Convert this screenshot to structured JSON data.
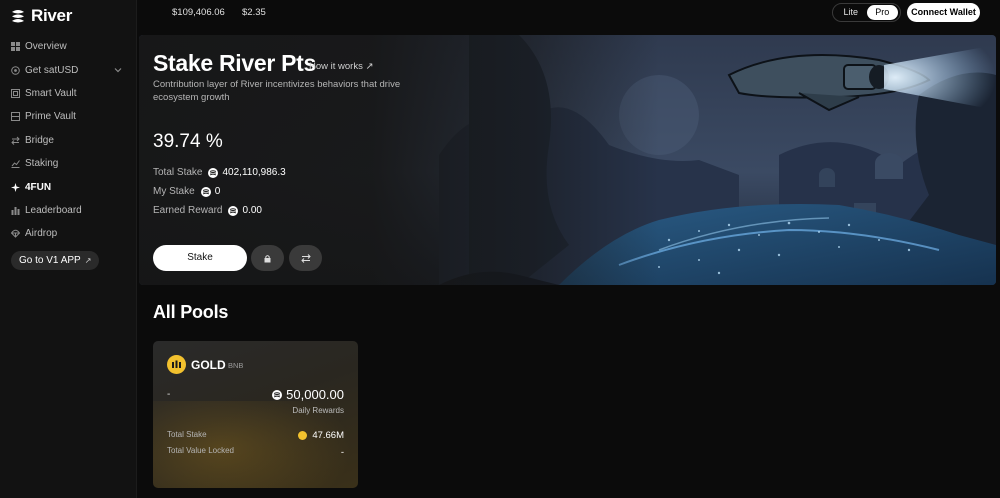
{
  "app": {
    "logo_text": "River"
  },
  "sidebar": {
    "items": [
      {
        "label": "Overview",
        "icon": "grid-icon"
      },
      {
        "label": "Get satUSD",
        "icon": "coin-icon",
        "has_chevron": true
      },
      {
        "label": "Smart Vault",
        "icon": "vault-icon"
      },
      {
        "label": "Prime Vault",
        "icon": "vault-icon"
      },
      {
        "label": "Bridge",
        "icon": "swap-icon"
      },
      {
        "label": "Staking",
        "icon": "chart-icon"
      },
      {
        "label": "4FUN",
        "icon": "spark-icon",
        "active": true
      },
      {
        "label": "Leaderboard",
        "icon": "bars-icon"
      },
      {
        "label": "Airdrop",
        "icon": "parachute-icon"
      }
    ],
    "v1_button": "Go to V1 APP"
  },
  "topbar": {
    "stat_1": "$109,406.06",
    "stat_2": "$2.35",
    "mode_options": [
      "Lite",
      "Pro"
    ],
    "mode_selected": "Pro",
    "connect_label": "Connect Wallet"
  },
  "hero": {
    "title": "Stake River Pts",
    "how_link": "How it works ↗",
    "subtitle": "Contribution layer of River incentivizes behaviors that drive ecosystem growth",
    "apy": "39.74 %",
    "total_stake_label": "Total Stake",
    "total_stake_value": "402,110,986.3",
    "my_stake_label": "My Stake",
    "my_stake_value": "0",
    "earned_label": "Earned Reward",
    "earned_value": "0.00",
    "stake_button": "Stake"
  },
  "pools": {
    "title": "All Pools",
    "cards": [
      {
        "name": "GOLD",
        "chain": "BNB",
        "left_value": "-",
        "daily_rewards_value": "50,000.00",
        "daily_rewards_label": "Daily Rewards",
        "total_stake_label": "Total Stake",
        "total_stake_value": "47.66M",
        "tvl_label": "Total Value Locked",
        "tvl_value": "-"
      }
    ]
  },
  "colors": {
    "accent_gold": "#f2c12e",
    "background": "#0b0b0b",
    "sidebar": "#121212"
  }
}
